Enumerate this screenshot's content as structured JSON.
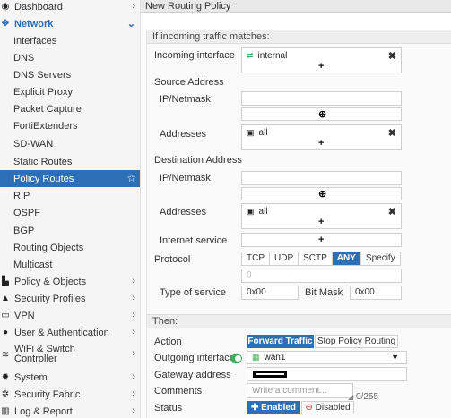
{
  "sidebar": {
    "dashboard": "Dashboard",
    "network": "Network",
    "network_items": [
      "Interfaces",
      "DNS",
      "DNS Servers",
      "Explicit Proxy",
      "Packet Capture",
      "FortiExtenders",
      "SD-WAN",
      "Static Routes",
      "Policy Routes",
      "RIP",
      "OSPF",
      "BGP",
      "Routing Objects",
      "Multicast"
    ],
    "policy_objects": "Policy & Objects",
    "security_profiles": "Security Profiles",
    "vpn": "VPN",
    "user_auth": "User & Authentication",
    "wifi_line1": "WiFi & Switch",
    "wifi_line2": "Controller",
    "system": "System",
    "security_fabric": "Security Fabric",
    "log_report": "Log & Report"
  },
  "header": {
    "title": "New Routing Policy"
  },
  "form": {
    "if_incoming": "If incoming traffic matches:",
    "incoming_interface_label": "Incoming interface",
    "incoming_interface_value": "internal",
    "source_address": "Source Address",
    "ip_netmask": "IP/Netmask",
    "addresses": "Addresses",
    "address_value": "all",
    "destination_address": "Destination Address",
    "internet_service": "Internet service",
    "protocol": "Protocol",
    "protocol_options": [
      "TCP",
      "UDP",
      "SCTP",
      "ANY",
      "Specify"
    ],
    "protocol_number": "0",
    "type_of_service": "Type of service",
    "tos_value": "0x00",
    "bit_mask": "Bit Mask",
    "bit_mask_value": "0x00",
    "then": "Then:",
    "action": "Action",
    "action_forward": "Forward Traffic",
    "action_stop": "Stop Policy Routing",
    "outgoing_interface": "Outgoing interface",
    "outgoing_value": "wan1",
    "gateway_address": "Gateway address",
    "comments": "Comments",
    "comments_placeholder": "Write a comment...",
    "char_count": "0/255",
    "status": "Status",
    "enabled": "Enabled",
    "disabled": "Disabled"
  },
  "colors": {
    "accent": "#2d6fb6",
    "toggle_on": "#3fae5a",
    "disabled_red": "#cc2b2b"
  }
}
